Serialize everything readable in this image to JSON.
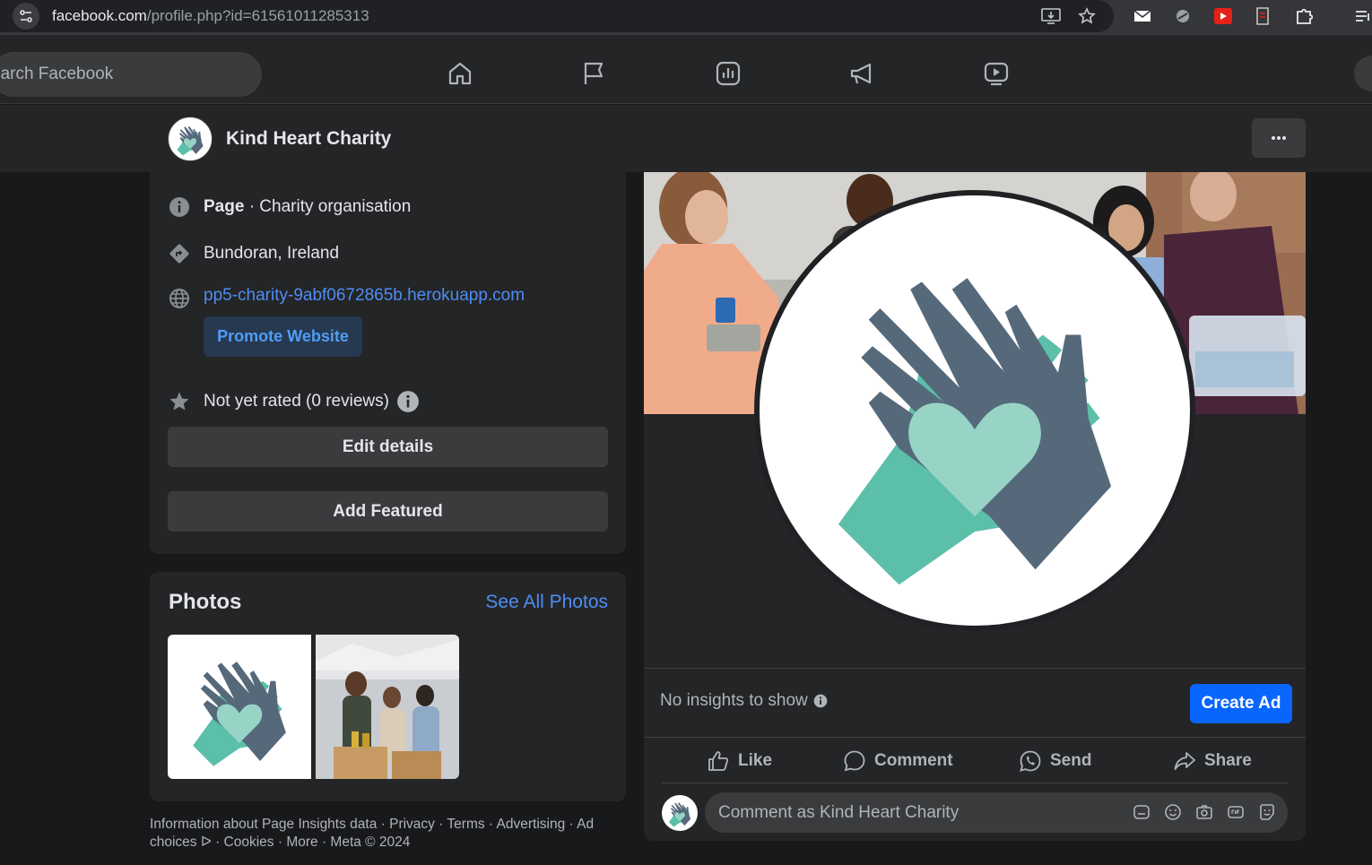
{
  "browser": {
    "url_domain": "facebook.com",
    "url_path": "/profile.php?id=61561011285313"
  },
  "nav": {
    "search_placeholder": "earch Facebook"
  },
  "page": {
    "name": "Kind Heart Charity"
  },
  "intro": {
    "category_bold": "Page",
    "category_rest": " · Charity organisation",
    "location": "Bundoran, Ireland",
    "website": "pp5-charity-9abf0672865b.herokuapp.com",
    "promote_label": "Promote Website",
    "rating": "Not yet rated (0 reviews)",
    "edit_label": "Edit details",
    "featured_label": "Add Featured"
  },
  "photos": {
    "title": "Photos",
    "see_all": "See All Photos"
  },
  "footer": {
    "text": "Information about Page Insights data · Privacy · Terms · Advertising · Ad choices ᐅ · Cookies · More · Meta © 2024"
  },
  "post": {
    "insights": "No insights to show",
    "create_ad": "Create Ad",
    "actions": {
      "like": "Like",
      "comment": "Comment",
      "send": "Send",
      "share": "Share"
    },
    "comment_placeholder": "Comment as Kind Heart Charity"
  },
  "colors": {
    "accent": "#0866ff",
    "link": "#4e8df5",
    "logo_teal": "#5bbfaa",
    "logo_slate": "#56697b",
    "logo_heart": "#97d4c6"
  }
}
